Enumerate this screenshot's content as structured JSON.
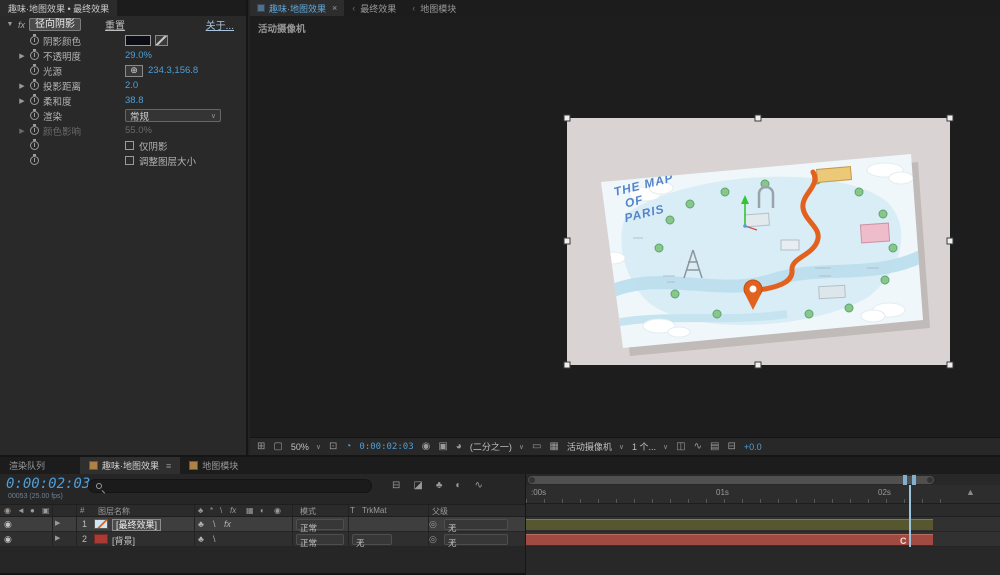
{
  "icons": {
    "twirl_open": "▼",
    "twirl_closed": "▶",
    "dropdown": "∨",
    "chevron": "‹",
    "close": "×",
    "menu": "≡",
    "crosshair": "⊕",
    "eye": "◉",
    "audio": "◄",
    "solo": "●",
    "lock": "▣",
    "quality": "♣",
    "star": "*",
    "slash": "\\",
    "fx": "fx",
    "motion_blur": "◐",
    "adjustment": "◉",
    "tgrid": "▦",
    "pickwhip": "◎",
    "grid": "⊞",
    "mask": "▢",
    "roi": "⊡",
    "clock": "◔",
    "camera": "◉",
    "snapshot": "▣",
    "channels": "◕",
    "region": "▭",
    "pixel": "◫",
    "fast": "∿",
    "tl": "▤",
    "flow": "⊟",
    "draft3d": "◪",
    "graph": "∿",
    "mountain": "▲"
  },
  "effects": {
    "tab": "趣味·地图效果 • 最终效果",
    "fx_badge": "fx",
    "name": "径向阴影",
    "reset": "重置",
    "about": "关于...",
    "rows": [
      {
        "label": "阴影颜色"
      },
      {
        "label": "不透明度",
        "value": "29.0%"
      },
      {
        "label": "光源",
        "value": "234.3,156.8"
      },
      {
        "label": "投影距离",
        "value": "2.0"
      },
      {
        "label": "柔和度",
        "value": "38.8"
      },
      {
        "label": "渲染",
        "value": "常规"
      },
      {
        "label": "颜色影响",
        "value": "55.0%"
      },
      {
        "label": "仅阴影"
      },
      {
        "label": "调整图层大小"
      }
    ]
  },
  "viewer": {
    "active_tab": "趣味·地图效果",
    "tab2": "最终效果",
    "tab3": "地图模块",
    "camera_overlay": "活动摄像机",
    "toolbar": {
      "zoom": "50%",
      "timecode": "0:00:02:03",
      "resolution": "(二分之一)",
      "camera": "活动摄像机",
      "views": "1 个...",
      "exposure": "+0.0"
    },
    "map": {
      "title_line1": "THE MAP",
      "title_line2": "OF",
      "title_line3": "PARIS"
    }
  },
  "timeline": {
    "tab_render_queue": "渲染队列",
    "tab_comp": "趣味·地图效果",
    "tab_module": "地图模块",
    "timecode": "0:00:02:03",
    "frame_info": "00053 (25.00 fps)",
    "header": {
      "hash": "#",
      "layer_name": "图层名称",
      "mode": "模式",
      "t": "T",
      "trkmat": "TrkMat",
      "parent": "父级"
    },
    "ruler": {
      "t0": ":00s",
      "t1": "01s",
      "t2": "02s"
    },
    "layers": [
      {
        "index": "1",
        "name": "[最终效果]",
        "mode": "正常",
        "parent": "无"
      },
      {
        "index": "2",
        "name": "[背景]",
        "mode": "正常",
        "trkmat": "无",
        "parent": "无"
      }
    ],
    "marker": "C"
  }
}
